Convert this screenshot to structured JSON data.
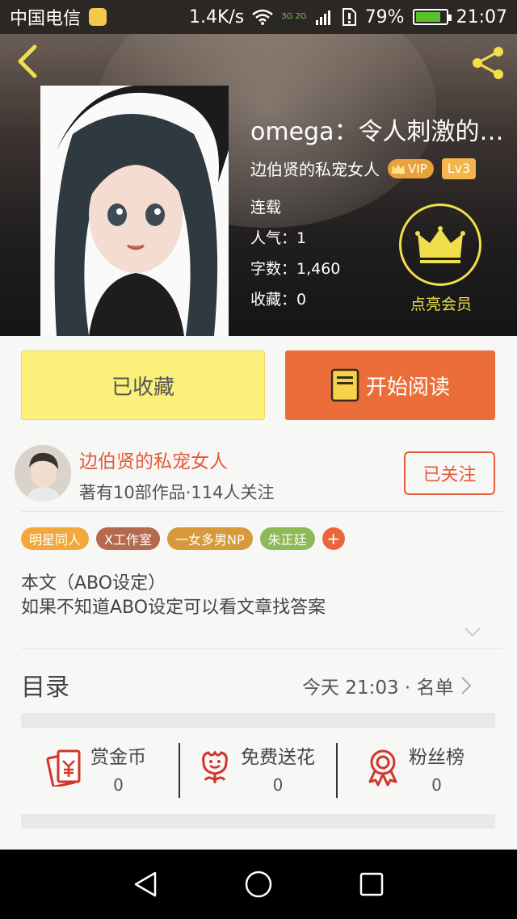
{
  "status_bar": {
    "carrier": "中国电信",
    "speed": "1.4K/s",
    "network": "3G 2G",
    "battery": "79%",
    "time": "21:07"
  },
  "book": {
    "title": "omega：令人刺激的…",
    "author": "边伯贤的私宠女人",
    "vip": "VIP",
    "level": "Lv3",
    "status": "连载",
    "popularity": "人气：1",
    "word_count": "字数：1,460",
    "favorites": "收藏：0"
  },
  "member": {
    "label": "点亮会员"
  },
  "actions": {
    "collected": "已收藏",
    "read": "开始阅读"
  },
  "author_info": {
    "name": "边伯贤的私宠女人",
    "stats": "著有10部作品·114人关注",
    "follow": "已关注"
  },
  "tags": [
    {
      "label": "明星同人",
      "color": "#f2a83a"
    },
    {
      "label": "X工作室",
      "color": "#b56a4f"
    },
    {
      "label": "一女多男NP",
      "color": "#d69a3a"
    },
    {
      "label": "朱正廷",
      "color": "#8dba57"
    }
  ],
  "tag_add": "+",
  "description": {
    "line1": "本文（ABO设定）",
    "line2": "如果不知道ABO设定可以看文章找答案"
  },
  "toc": {
    "title": "目录",
    "update": "今天 21:03 · 名单"
  },
  "stats": [
    {
      "label": "赏金币",
      "value": "0",
      "icon": "red-envelope-icon"
    },
    {
      "label": "免费送花",
      "value": "0",
      "icon": "flower-icon"
    },
    {
      "label": "粉丝榜",
      "value": "0",
      "icon": "medal-icon"
    }
  ],
  "colors": {
    "accent": "#eb6e3a",
    "author_red": "#e45a3a",
    "member_yellow": "#f0df4a",
    "collected_yellow": "#fbf07a"
  }
}
